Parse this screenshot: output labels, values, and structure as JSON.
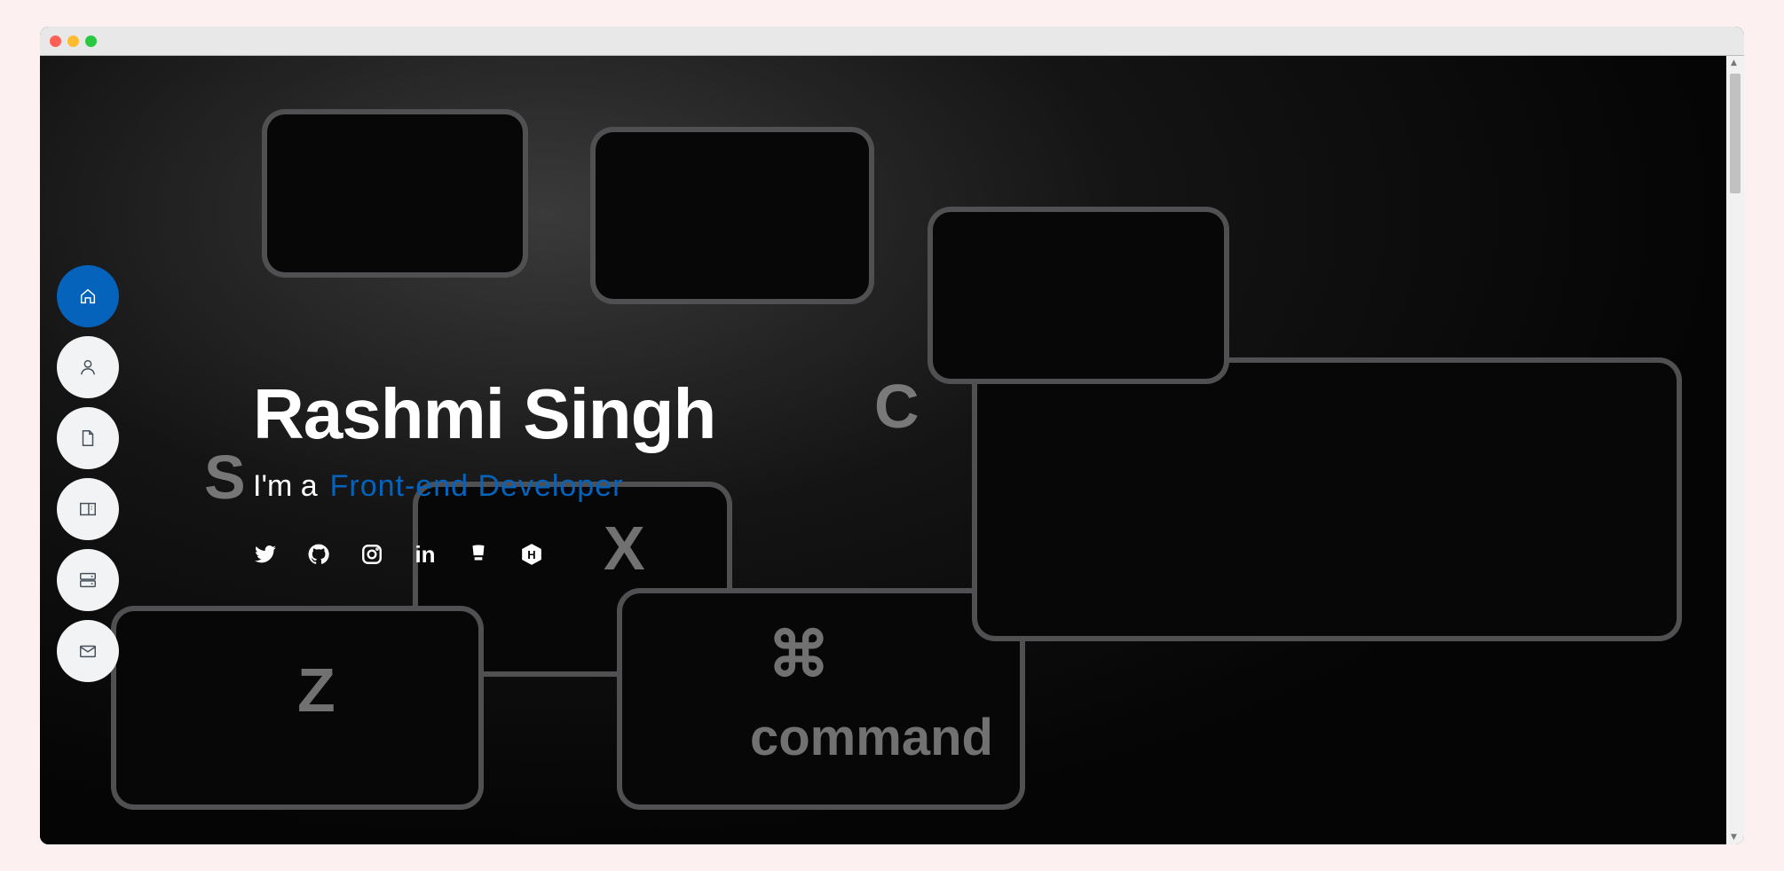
{
  "window": {
    "controls": [
      "close",
      "minimize",
      "maximize"
    ],
    "colors": {
      "close": "#ff5f57",
      "minimize": "#febc2e",
      "maximize": "#28c840"
    }
  },
  "nav": {
    "accent": "#0563bb",
    "items": [
      {
        "icon": "home-icon",
        "active": true
      },
      {
        "icon": "person-icon",
        "active": false
      },
      {
        "icon": "file-icon",
        "active": false
      },
      {
        "icon": "book-icon",
        "active": false
      },
      {
        "icon": "server-icon",
        "active": false
      },
      {
        "icon": "envelope-icon",
        "active": false
      }
    ]
  },
  "hero": {
    "name": "Rashmi Singh",
    "prefix": "I'm a",
    "role": "Front-end Developer"
  },
  "background_keys": [
    "S",
    "X",
    "Z",
    "C",
    "command",
    "⌘"
  ],
  "social": [
    {
      "icon": "twitter-icon"
    },
    {
      "icon": "github-icon"
    },
    {
      "icon": "instagram-icon"
    },
    {
      "icon": "linkedin-icon",
      "text": "in"
    },
    {
      "icon": "codechef-icon"
    },
    {
      "icon": "hackerrank-icon",
      "text": "H"
    }
  ]
}
